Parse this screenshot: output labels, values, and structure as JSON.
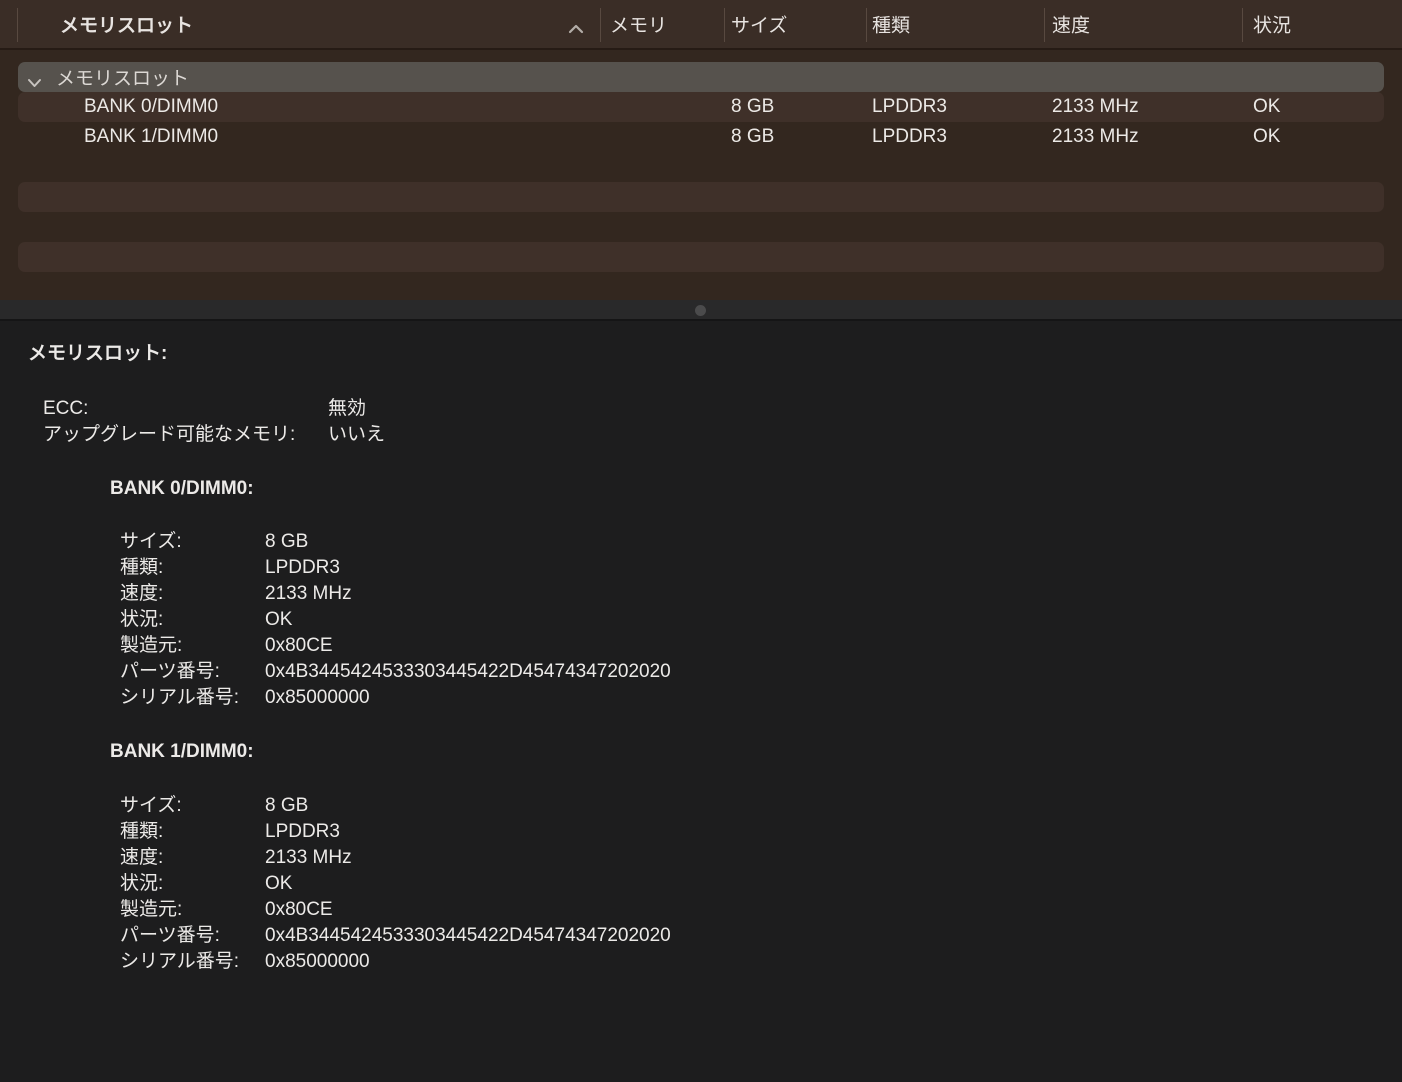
{
  "table": {
    "columns": [
      {
        "label": "メモリスロット",
        "sorted": true
      },
      {
        "label": "メモリ"
      },
      {
        "label": "サイズ"
      },
      {
        "label": "種類"
      },
      {
        "label": "速度"
      },
      {
        "label": "状況"
      }
    ],
    "group_row": {
      "label": "メモリスロット"
    },
    "rows": [
      {
        "name": "BANK 0/DIMM0",
        "size": "8 GB",
        "type": "LPDDR3",
        "speed": "2133 MHz",
        "status": "OK"
      },
      {
        "name": "BANK 1/DIMM0",
        "size": "8 GB",
        "type": "LPDDR3",
        "speed": "2133 MHz",
        "status": "OK"
      }
    ]
  },
  "details": {
    "title": "メモリスロット:",
    "summary": [
      {
        "label": "ECC:",
        "value": "無効"
      },
      {
        "label": "アップグレード可能なメモリ:",
        "value": "いいえ"
      }
    ],
    "banks": [
      {
        "heading": "BANK 0/DIMM0:"
      },
      {
        "heading": "BANK 1/DIMM0:"
      }
    ],
    "bank0_fields": [
      {
        "label": "サイズ:",
        "value": "8 GB"
      },
      {
        "label": "種類:",
        "value": "LPDDR3"
      },
      {
        "label": "速度:",
        "value": "2133 MHz"
      },
      {
        "label": "状況:",
        "value": "OK"
      },
      {
        "label": "製造元:",
        "value": "0x80CE"
      },
      {
        "label": "パーツ番号:",
        "value": "0x4B3445424533303445422D45474347202020"
      },
      {
        "label": "シリアル番号:",
        "value": "0x85000000"
      }
    ],
    "bank1_fields": [
      {
        "label": "サイズ:",
        "value": "8 GB"
      },
      {
        "label": "種類:",
        "value": "LPDDR3"
      },
      {
        "label": "速度:",
        "value": "2133 MHz"
      },
      {
        "label": "状況:",
        "value": "OK"
      },
      {
        "label": "製造元:",
        "value": "0x80CE"
      },
      {
        "label": "パーツ番号:",
        "value": "0x4B3445424533303445422D45474347202020"
      },
      {
        "label": "シリアル番号:",
        "value": "0x85000000"
      }
    ]
  },
  "icons": {
    "sort_ascending": "chevron-up-icon",
    "group_disclosure": "chevron-down-icon",
    "splitter_handle": "drag-handle-dot"
  },
  "colors": {
    "header_bg": "#3a2d26",
    "table_bg": "#33271f",
    "row_stripe": "#3f3029",
    "selected_group_row": "#56524d",
    "detail_pane_bg": "#1d1d1e",
    "text": "#ece9e6",
    "splitter_bg": "#29292a"
  }
}
